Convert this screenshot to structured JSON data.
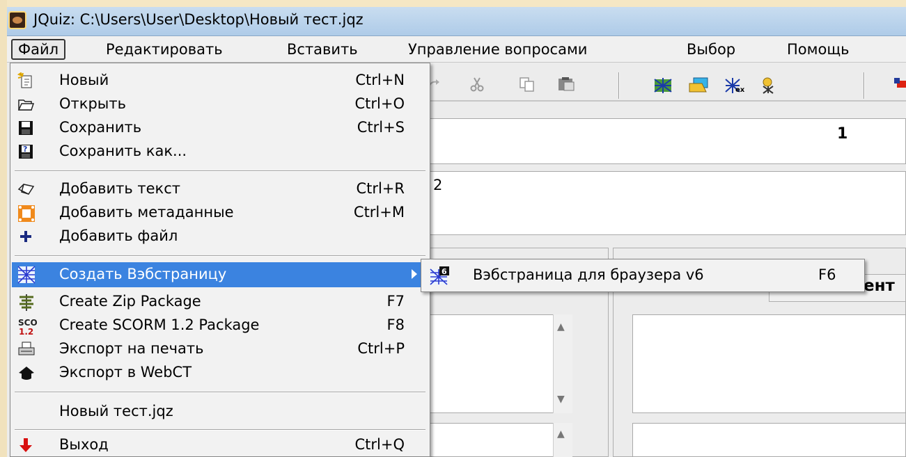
{
  "window": {
    "title": "JQuiz: C:\\Users\\User\\Desktop\\Новый тест.jqz"
  },
  "menubar": {
    "file": "Файл",
    "edit": "Редактировать",
    "insert": "Вставить",
    "manage": "Управление вопросами",
    "options": "Выбор",
    "help": "Помощь"
  },
  "content": {
    "question_number": "1",
    "visible_text": "2",
    "partial_label": "ент"
  },
  "file_menu": {
    "items": [
      {
        "label": "Новый",
        "shortcut": "Ctrl+N",
        "icon": "new-file-icon"
      },
      {
        "label": "Открыть",
        "shortcut": "Ctrl+O",
        "icon": "open-folder-icon"
      },
      {
        "label": "Сохранить",
        "shortcut": "Ctrl+S",
        "icon": "save-disk-icon"
      },
      {
        "label": "Сохранить как...",
        "shortcut": "",
        "icon": "save-as-icon"
      },
      {
        "label": "Добавить текст",
        "shortcut": "Ctrl+R",
        "icon": "add-text-icon"
      },
      {
        "label": "Добавить метаданные",
        "shortcut": "Ctrl+M",
        "icon": "metadata-icon"
      },
      {
        "label": "Добавить файл",
        "shortcut": "",
        "icon": "plus-icon"
      },
      {
        "label": "Создать Вэбстраницу",
        "shortcut": "",
        "icon": "web-page-icon"
      },
      {
        "label": "Create Zip Package",
        "shortcut": "F7",
        "icon": "zip-icon"
      },
      {
        "label": "Create SCORM 1.2 Package",
        "shortcut": "F8",
        "icon": "scorm-icon"
      },
      {
        "label": "Экспорт на печать",
        "shortcut": "Ctrl+P",
        "icon": "printer-icon"
      },
      {
        "label": "Экспорт в WebCT",
        "shortcut": "",
        "icon": "webct-icon"
      },
      {
        "label": "Новый тест.jqz",
        "shortcut": "",
        "icon": ""
      },
      {
        "label": "Выход",
        "shortcut": "Ctrl+Q",
        "icon": "exit-arrow-icon"
      }
    ]
  },
  "submenu": {
    "item_label": "Вэбстраница для браузера v6",
    "item_shortcut": "F6",
    "item_icon": "web-v6-icon",
    "scorm_icon_text_top": "SCO",
    "scorm_icon_text_bottom": "1.2",
    "v6_badge": "6"
  },
  "colors": {
    "highlight": "#3b83e0",
    "titlebar": "#aecbe8",
    "menu_bg": "#f2f2f2"
  }
}
